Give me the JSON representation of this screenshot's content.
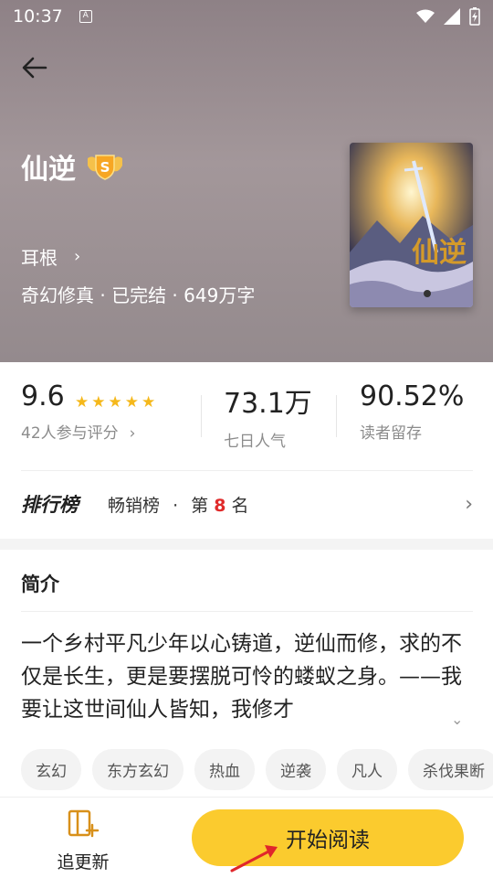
{
  "status": {
    "time": "10:37",
    "notif_glyph": "A"
  },
  "book": {
    "title": "仙逆",
    "badge_letter": "S",
    "author": "耳根",
    "meta": "奇幻修真 · 已完结 · 649万字",
    "cover_title": "仙逆"
  },
  "stats": {
    "rating": "9.6",
    "rating_label": "42人参与评分",
    "popularity": "73.1万",
    "popularity_label": "七日人气",
    "retention": "90.52%",
    "retention_label": "读者留存"
  },
  "rank": {
    "title": "排行榜",
    "list": "畅销榜",
    "sep": "·",
    "prefix": "第",
    "number": "8",
    "suffix": "名"
  },
  "intro": {
    "heading": "简介",
    "text": "一个乡村平凡少年以心铸道，逆仙而修，求的不仅是长生，更是要摆脱可怜的蝼蚁之身。——我要让这世间仙人皆知，我修才",
    "tags": [
      "玄幻",
      "东方玄幻",
      "热血",
      "逆袭",
      "凡人",
      "杀伐果断"
    ]
  },
  "bottom": {
    "follow_label": "追更新",
    "read_label": "开始阅读"
  },
  "colors": {
    "accent": "#fbcb2e",
    "star": "#f5b81b",
    "rank_number": "#e02b2b"
  }
}
